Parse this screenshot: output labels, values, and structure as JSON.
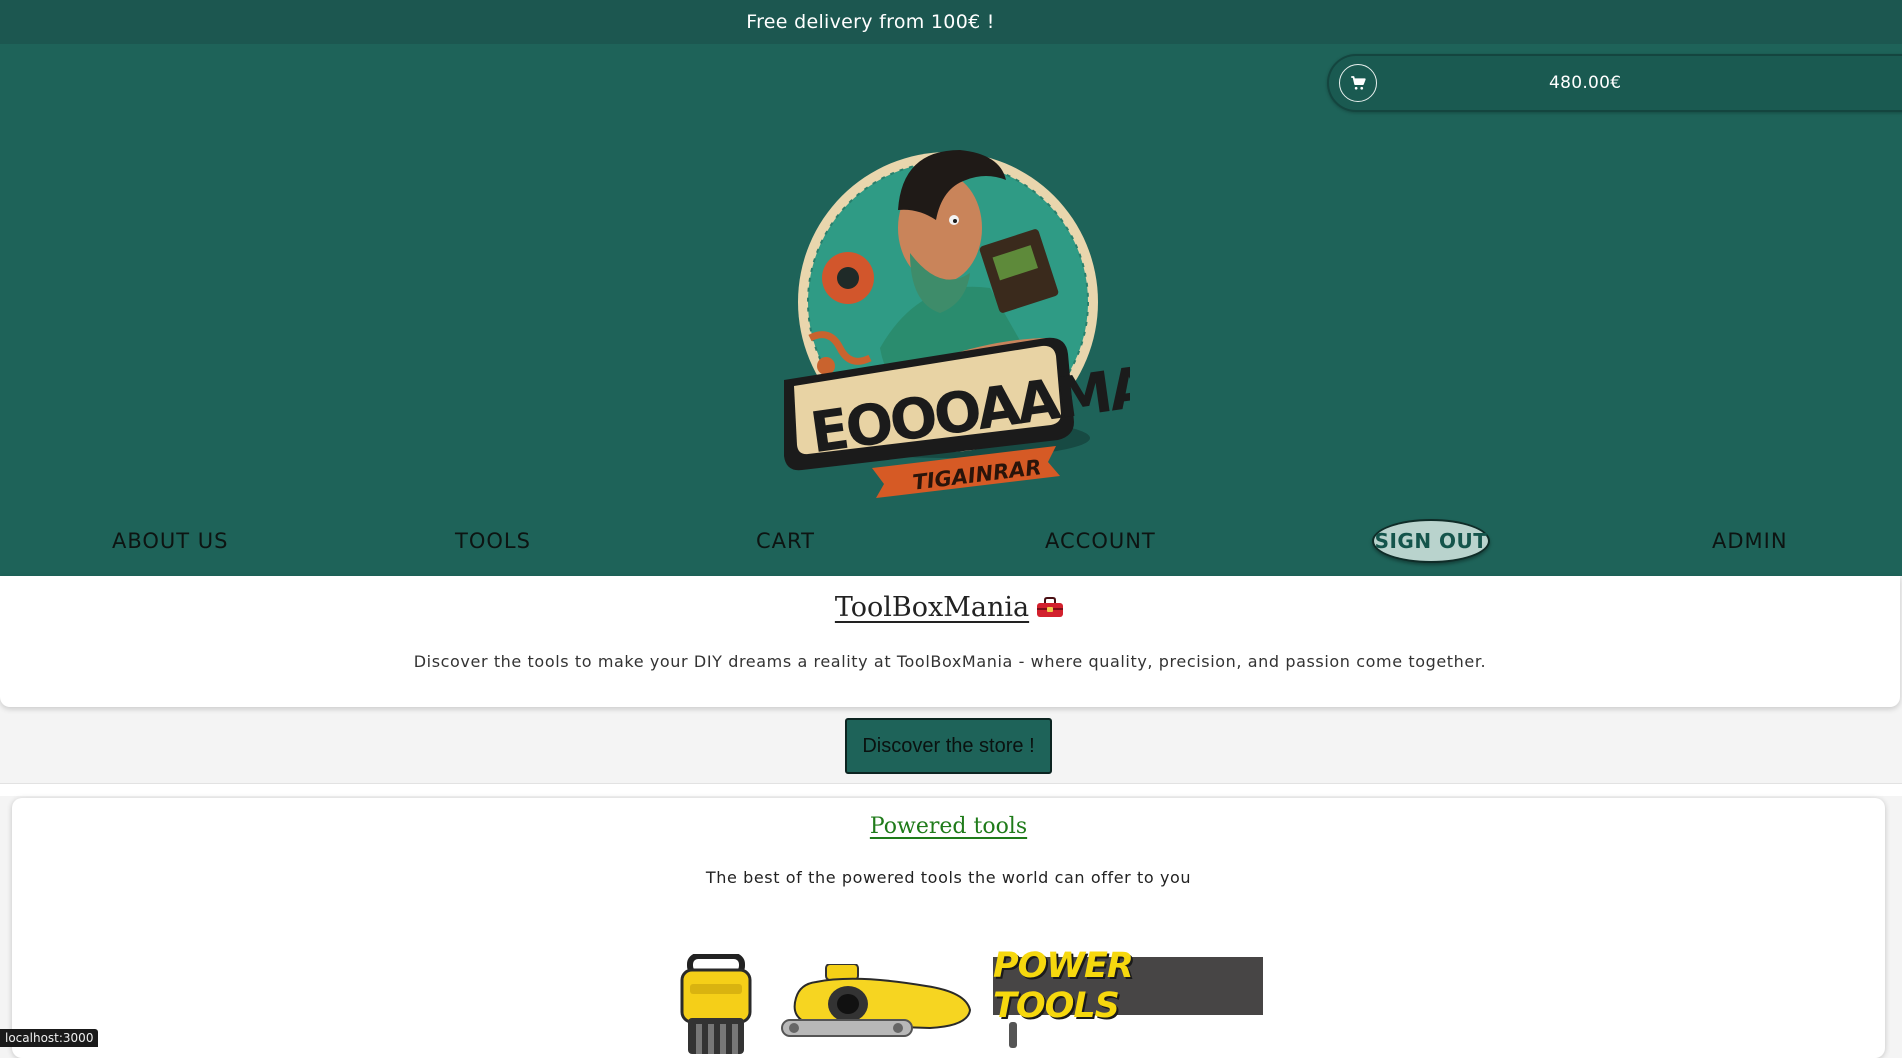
{
  "promo": {
    "text": "Free delivery from 100€ !"
  },
  "cart": {
    "icon": "cart-icon",
    "total": "480.00€"
  },
  "logo": {
    "banner_text": "EOOOAAMAM",
    "ribbon_text": "TIGAINRAR"
  },
  "nav": {
    "about": "ABOUT US",
    "tools": "TOOLS",
    "cart": "CART",
    "account": "ACCOUNT",
    "signout": "SIGN OUT",
    "admin": "ADMIN"
  },
  "intro": {
    "title": "ToolBoxMania",
    "title_icon": "toolbox-icon",
    "tagline": "Discover the tools to make your DIY dreams a reality at ToolBoxMania - where quality, precision, and passion come together."
  },
  "cta": {
    "label": "Discover the store !"
  },
  "section": {
    "title": "Powered tools",
    "subtitle": "The best of the powered tools the world can offer to you",
    "banner_text": "POWER TOOLS"
  },
  "status": {
    "url": "localhost:3000"
  },
  "colors": {
    "header": "#1e6359",
    "promo": "#1c5750",
    "section_title": "#1f7b1a",
    "signout_bg": "#b9d3cd"
  }
}
